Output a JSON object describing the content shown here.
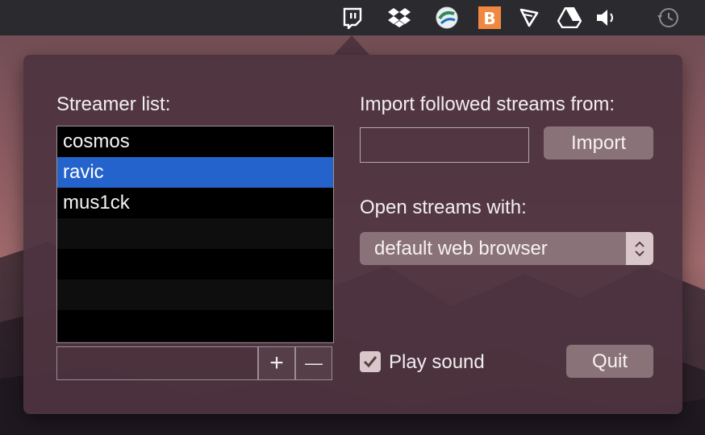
{
  "menubar": {
    "icons": [
      "twitch-icon",
      "dropbox-icon",
      "globe-icon",
      "bitcoin-icon",
      "scrypt-icon",
      "google-drive-icon",
      "volume-icon",
      "time-machine-icon"
    ]
  },
  "left": {
    "title": "Streamer list:",
    "streamers": [
      "cosmos",
      "ravic",
      "mus1ck"
    ],
    "selected_index": 1,
    "add_symbol": "+",
    "remove_symbol": "—"
  },
  "right": {
    "import_label": "Import followed streams from:",
    "import_value": "",
    "import_button": "Import",
    "open_label": "Open streams with:",
    "open_value": "default web browser",
    "play_sound_label": "Play sound",
    "play_sound_checked": true,
    "quit_button": "Quit"
  }
}
